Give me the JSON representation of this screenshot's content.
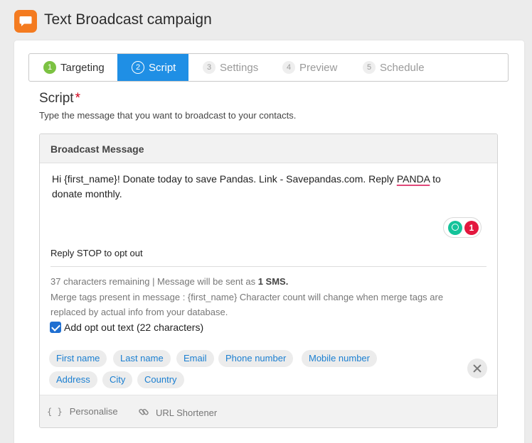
{
  "header": {
    "title": "Text Broadcast campaign",
    "logo_icon": "chat-bubble-icon",
    "brand_color": "#f47b20"
  },
  "steps": [
    {
      "num": "1",
      "label": "Targeting",
      "state": "done"
    },
    {
      "num": "2",
      "label": "Script",
      "state": "active"
    },
    {
      "num": "3",
      "label": "Settings",
      "state": "pending"
    },
    {
      "num": "4",
      "label": "Preview",
      "state": "pending"
    },
    {
      "num": "5",
      "label": "Schedule",
      "state": "pending"
    }
  ],
  "script": {
    "title": "Script",
    "required_mark": "*",
    "description": "Type the message that you want to broadcast to your contacts."
  },
  "broadcast": {
    "panel_title": "Broadcast Message",
    "message_before": "Hi {first_name}! Donate today to save Pandas. Link - Savepandas.com. Reply ",
    "message_flagged": "PANDA",
    "message_after": " to donate monthly.",
    "grammar_count": "1",
    "optout_line": "Reply STOP to opt out",
    "remaining_text": "37 characters remaining | Message will be sent as ",
    "sms_count": "1 SMS.",
    "merge_note": "Merge tags present in message : {first_name} Character count will change when merge tags are replaced by actual info from your database.",
    "optout_checkbox_label": "Add opt out text (22 characters)",
    "optout_checked": true
  },
  "merge_tags": [
    "First name",
    "Last name",
    "Email",
    "Phone number",
    "Mobile number",
    "Address",
    "City",
    "Country"
  ],
  "toolbar": {
    "personalise_icon": "{ }",
    "personalise_label": "Personalise",
    "url_label": "URL Shortener"
  },
  "colors": {
    "accent": "#1f8fe5",
    "done": "#7cc242",
    "required": "#d0021b",
    "tag_text": "#1b7fd1"
  }
}
